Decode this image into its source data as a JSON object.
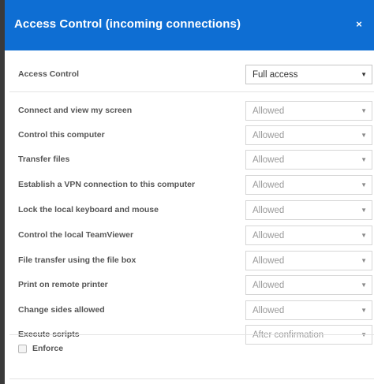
{
  "dialog": {
    "title": "Access Control (incoming connections)",
    "close_label": "×"
  },
  "access_control": {
    "label": "Access Control",
    "value": "Full access"
  },
  "permissions": [
    {
      "label": "Connect and view my screen",
      "value": "Allowed"
    },
    {
      "label": "Control this computer",
      "value": "Allowed"
    },
    {
      "label": "Transfer files",
      "value": "Allowed"
    },
    {
      "label": "Establish a VPN connection to this computer",
      "value": "Allowed"
    },
    {
      "label": "Lock the local keyboard and mouse",
      "value": "Allowed"
    },
    {
      "label": "Control the local TeamViewer",
      "value": "Allowed"
    },
    {
      "label": "File transfer using the file box",
      "value": "Allowed"
    },
    {
      "label": "Print on remote printer",
      "value": "Allowed"
    },
    {
      "label": "Change sides allowed",
      "value": "Allowed"
    },
    {
      "label": "Execute scripts",
      "value": "After confirmation"
    }
  ],
  "enforce": {
    "label": "Enforce",
    "checked": false
  },
  "icons": {
    "caret": "▼"
  },
  "colors": {
    "header": "#0e6ed3",
    "label": "#555555",
    "disabled_value": "#9a9a9a"
  }
}
